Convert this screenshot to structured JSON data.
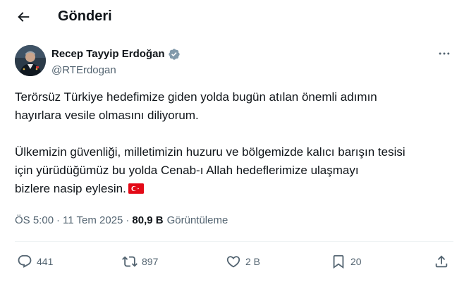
{
  "header": {
    "back_icon": "arrow-left-icon",
    "title": "Gönderi"
  },
  "author": {
    "name": "Recep Tayyip Erdoğan",
    "handle": "@RTErdogan",
    "verified_icon": "verified-badge-icon",
    "verified_color": "#1d9bf0"
  },
  "more_icon": "more-horizontal-icon",
  "tweet": {
    "paragraph1_line1": "Terörsüz Türkiye hedefimize giden yolda bugün atılan önemli adımın",
    "paragraph1_line2": "hayırlara vesile olmasını diliyorum.",
    "paragraph2_line1": "Ülkemizin güvenliği, milletimizin huzuru ve bölgemizde kalıcı barışın tesisi",
    "paragraph2_line2": "için yürüdüğümüz bu yolda Cenab-ı Allah hedeflerimize ulaşmayı",
    "paragraph2_line3": "bizlere nasip eylesin.",
    "flag_emoji": "turkey-flag-icon"
  },
  "meta": {
    "time": "ÖS 5:00",
    "separator": "·",
    "date": "11 Tem 2025",
    "views_count": "80,9 B",
    "views_label": "Görüntüleme"
  },
  "actions": {
    "reply_count": "441",
    "repost_count": "897",
    "like_count": "2 B",
    "bookmark_count": "20"
  },
  "colors": {
    "text_primary": "#0f1419",
    "text_secondary": "#536471",
    "divider": "#eff3f4",
    "flag_red": "#e30a17"
  }
}
